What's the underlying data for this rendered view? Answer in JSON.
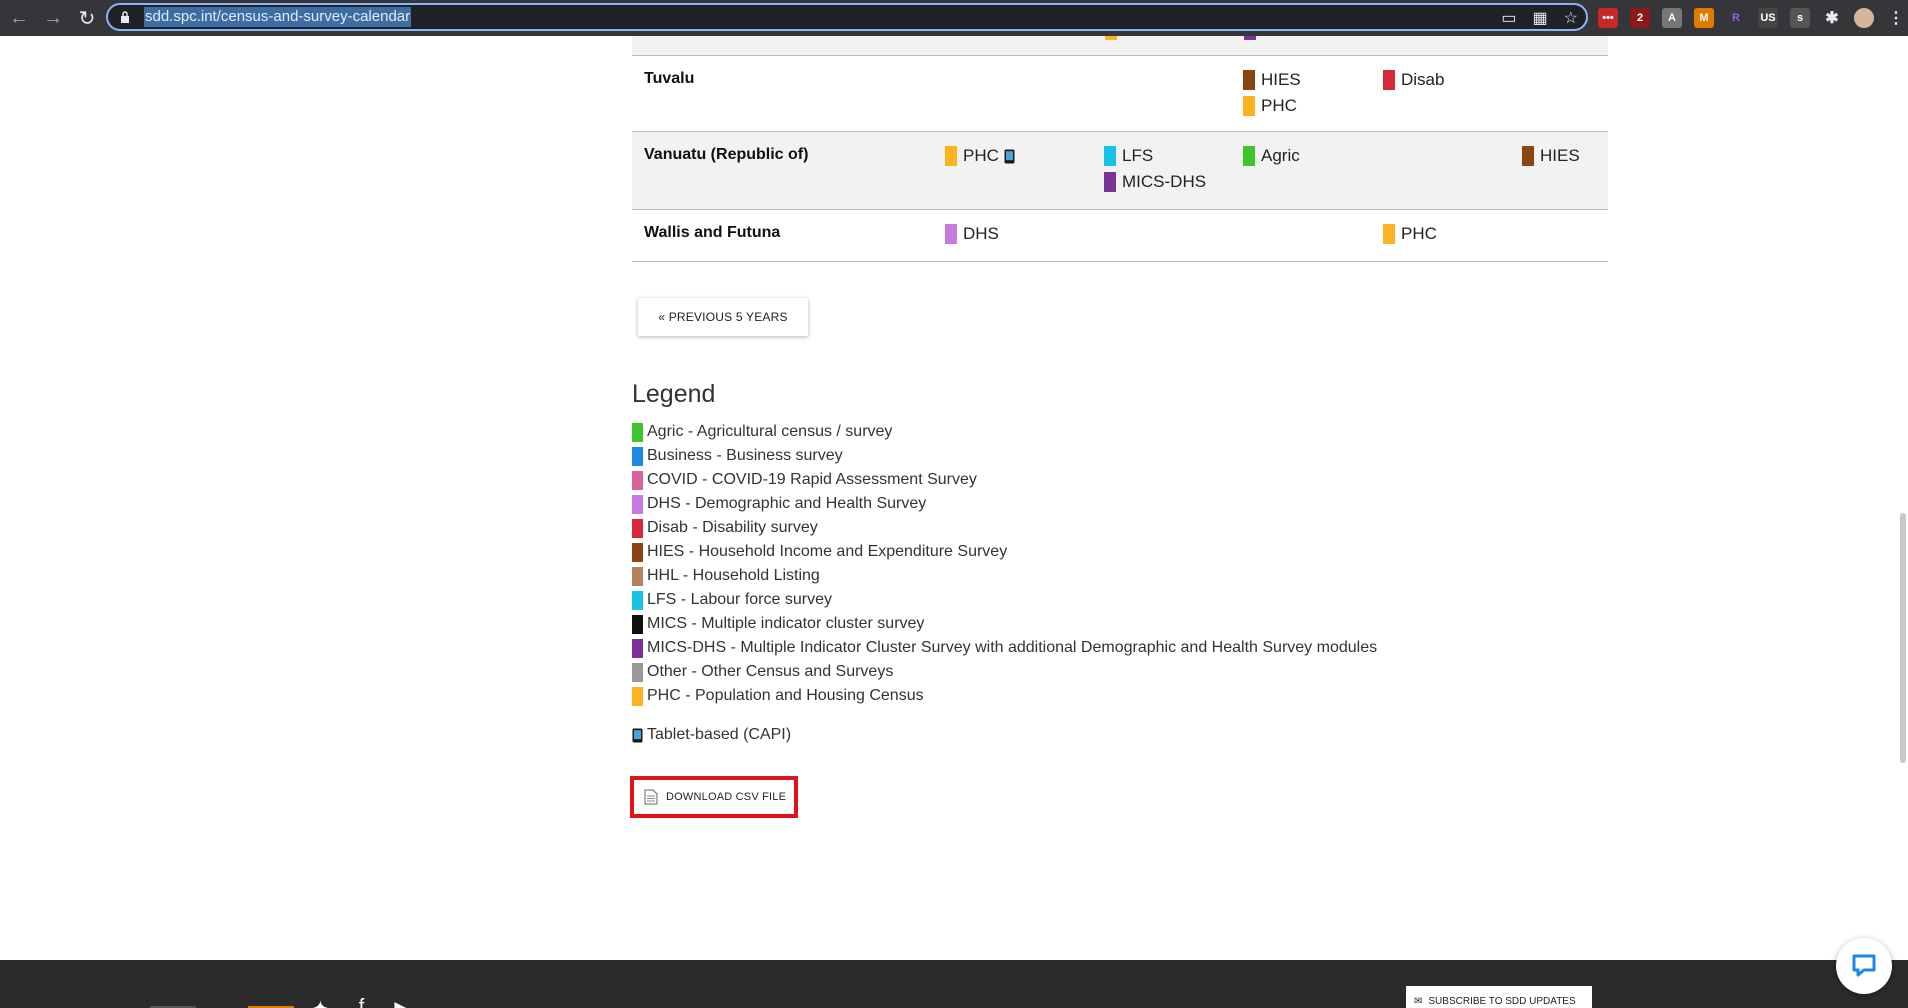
{
  "browser": {
    "url": "sdd.spc.int/census-and-survey-calendar",
    "extension_badge_count": "2",
    "profile_region": "US"
  },
  "table": {
    "rows": [
      {
        "country": "Tuvalu",
        "shaded": false,
        "cells": [
          {
            "col": 3,
            "items": [
              {
                "code": "HIES",
                "color": "#8b4513"
              },
              {
                "code": "PHC",
                "color": "#fbb41f"
              }
            ]
          },
          {
            "col": 4,
            "items": [
              {
                "code": "Disab",
                "color": "#d9263a"
              }
            ]
          }
        ]
      },
      {
        "country": "Vanuatu (Republic of)",
        "shaded": true,
        "cells": [
          {
            "col": 1,
            "items": [
              {
                "code": "PHC",
                "color": "#fbb41f",
                "tablet": true
              }
            ]
          },
          {
            "col": 2,
            "items": [
              {
                "code": "LFS",
                "color": "#18c3e8"
              },
              {
                "code": "MICS-DHS",
                "color": "#7a3296"
              }
            ]
          },
          {
            "col": 3,
            "items": [
              {
                "code": "Agric",
                "color": "#3ec52b"
              }
            ]
          },
          {
            "col": 5,
            "items": [
              {
                "code": "HIES",
                "color": "#8b4513"
              }
            ]
          }
        ]
      },
      {
        "country": "Wallis and Futuna",
        "shaded": false,
        "cells": [
          {
            "col": 1,
            "items": [
              {
                "code": "DHS",
                "color": "#c77be0"
              }
            ]
          },
          {
            "col": 4,
            "items": [
              {
                "code": "PHC",
                "color": "#fbb41f"
              }
            ]
          }
        ]
      }
    ]
  },
  "pagination": {
    "previous_label": "« PREVIOUS 5 YEARS"
  },
  "legend": {
    "title": "Legend",
    "items": [
      {
        "text": "Agric - Agricultural census / survey",
        "color": "#3ec52b"
      },
      {
        "text": "Business - Business survey",
        "color": "#1e88e5"
      },
      {
        "text": "COVID - COVID-19 Rapid Assessment Survey",
        "color": "#d9649b"
      },
      {
        "text": "DHS - Demographic and Health Survey",
        "color": "#c77be0"
      },
      {
        "text": "Disab - Disability survey",
        "color": "#d9263a"
      },
      {
        "text": "HIES - Household Income and Expenditure Survey",
        "color": "#8b4513"
      },
      {
        "text": "HHL - Household Listing",
        "color": "#b5835a"
      },
      {
        "text": "LFS - Labour force survey",
        "color": "#18c3e8"
      },
      {
        "text": "MICS - Multiple indicator cluster survey",
        "color": "#111111"
      },
      {
        "text": "MICS-DHS - Multiple Indicator Cluster Survey with additional Demographic and Health Survey modules",
        "color": "#7a3296"
      },
      {
        "text": "Other - Other Census and Surveys",
        "color": "#999999"
      },
      {
        "text": "PHC - Population and Housing Census",
        "color": "#fbb41f"
      }
    ],
    "tablet_note": "Tablet-based (CAPI)"
  },
  "download": {
    "label": "DOWNLOAD CSV FILE"
  },
  "footer": {
    "subscribe_label": "SUBSCRIBE TO SDD UPDATES"
  }
}
